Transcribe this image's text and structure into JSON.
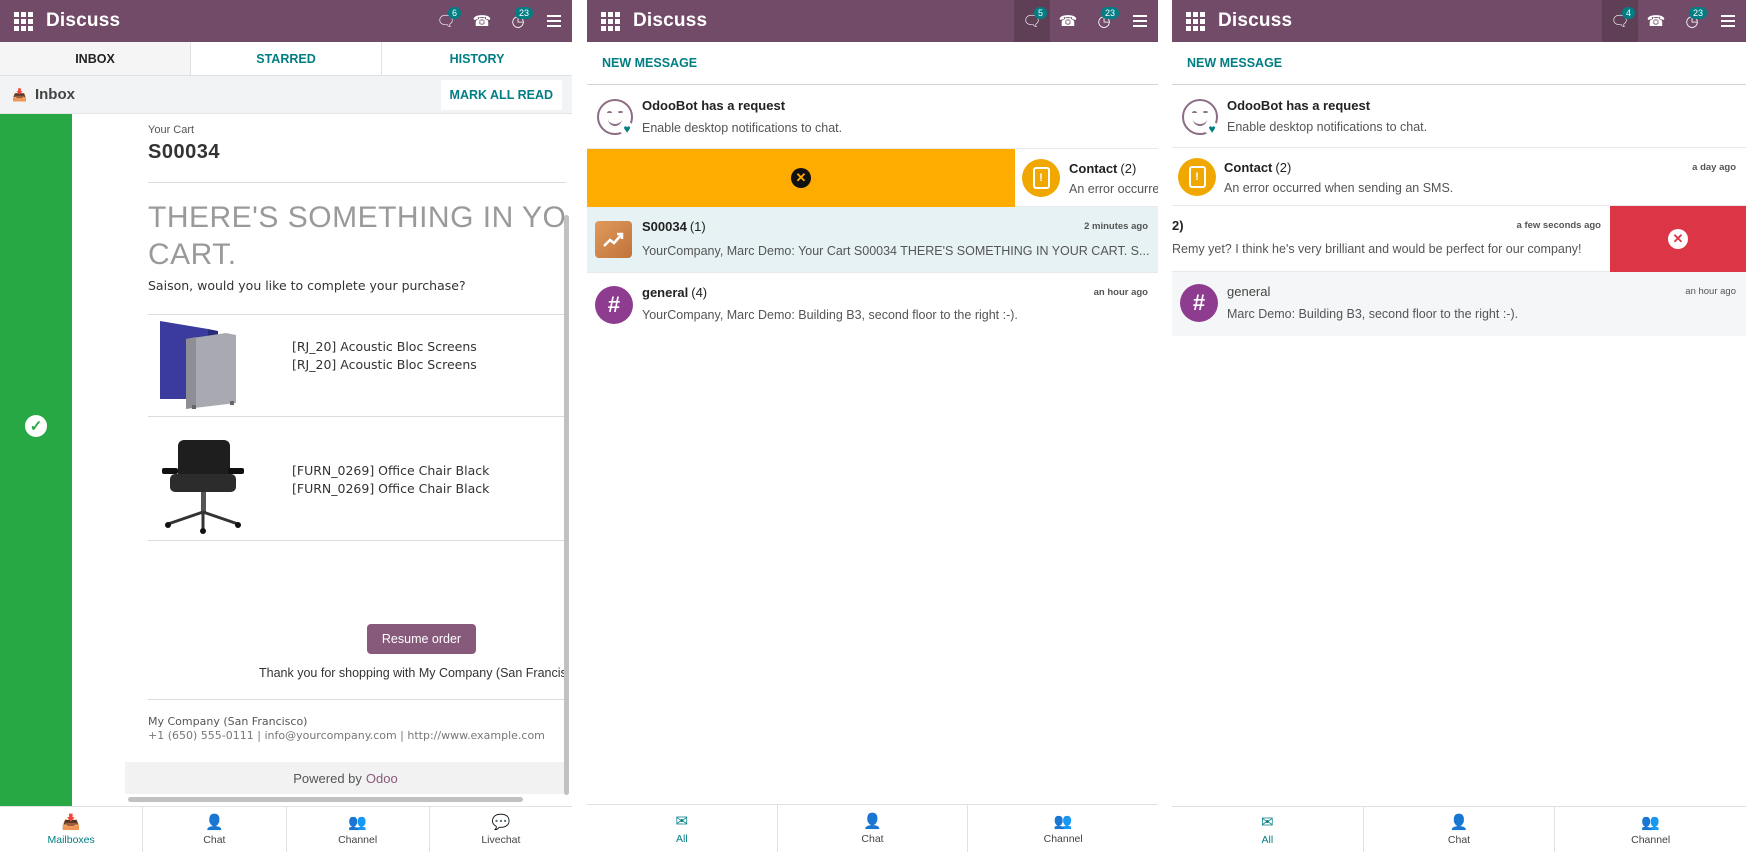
{
  "panel1": {
    "app_title": "Discuss",
    "badges": {
      "chat": "6",
      "activity": "23"
    },
    "tabs": [
      "INBOX",
      "STARRED",
      "HISTORY"
    ],
    "inbox_label": "Inbox",
    "mark_all_read": "MARK ALL READ",
    "mail": {
      "your_cart": "Your Cart",
      "order_ref": "S00034",
      "headline": "THERE'S SOMETHING IN YOUR CART.",
      "question": "Saison, would you like to complete your purchase?",
      "products": [
        {
          "line1": "[RJ_20] Acoustic Bloc Screens",
          "line2": "[RJ_20] Acoustic Bloc Screens"
        },
        {
          "line1": "[FURN_0269] Office Chair Black",
          "line2": "[FURN_0269] Office Chair Black"
        }
      ],
      "resume_button": "Resume order",
      "thanks": "Thank you for shopping with My Company (San Francisco)!",
      "company": "My Company (San Francisco)",
      "contact": "+1 (650) 555-0111 | info@yourcompany.com | http://www.example.com",
      "powered_by": "Powered by",
      "powered_brand": "Odoo"
    },
    "bottom_nav": [
      "Mailboxes",
      "Chat",
      "Channel",
      "Livechat"
    ]
  },
  "panel2": {
    "app_title": "Discuss",
    "badges": {
      "chat": "5",
      "activity": "23"
    },
    "new_message": "NEW MESSAGE",
    "odoobot": {
      "name": "OdooBot has a request",
      "preview": "Enable desktop notifications to chat."
    },
    "contact": {
      "name": "Contact",
      "count": "(2)",
      "preview": "An error occurred when sending an SMS."
    },
    "s00034": {
      "name": "S00034",
      "count": "(1)",
      "time": "2 minutes ago",
      "preview": "YourCompany, Marc Demo: Your Cart S00034 THERE'S SOMETHING IN YOUR CART. S..."
    },
    "general": {
      "name": "general",
      "count": "(4)",
      "time": "an hour ago",
      "preview": "YourCompany, Marc Demo: Building B3, second floor to the right :-)."
    },
    "bottom_nav": [
      "All",
      "Chat",
      "Channel"
    ]
  },
  "panel3": {
    "app_title": "Discuss",
    "badges": {
      "chat": "4",
      "activity": "23"
    },
    "new_message": "NEW MESSAGE",
    "odoobot": {
      "name": "OdooBot has a request",
      "preview": "Enable desktop notifications to chat."
    },
    "contact": {
      "name": "Contact",
      "count": "(2)",
      "time": "a day ago",
      "preview": "An error occurred when sending an SMS."
    },
    "swiped": {
      "name": "2)",
      "time": "a few seconds ago",
      "preview": "Remy yet? I think he's very brilliant and would be perfect for our company!"
    },
    "general": {
      "name": "general",
      "time": "an hour ago",
      "preview": "Marc Demo: Building B3, second floor to the right :-)."
    },
    "bottom_nav": [
      "All",
      "Chat",
      "Channel"
    ]
  },
  "colors": {
    "brand": "#714b67",
    "accent": "#017e84",
    "success": "#28a745",
    "warning": "#ffac00",
    "danger": "#dc3545"
  },
  "icons": [
    "apps-grid-icon",
    "chat-bubbles-icon",
    "phone-icon",
    "activity-clock-icon",
    "hamburger-menu-icon",
    "inbox-icon",
    "check-circle-icon",
    "close-circle-icon",
    "warning-phone-icon",
    "hash-icon",
    "envelope-icon",
    "user-icon",
    "users-icon",
    "comments-icon"
  ]
}
